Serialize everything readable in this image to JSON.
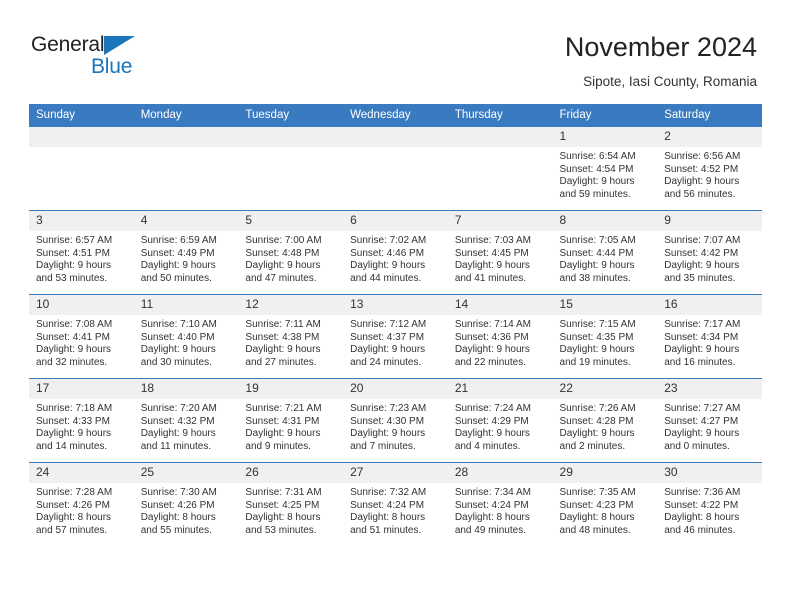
{
  "brand": {
    "name_part1": "General",
    "name_part2": "Blue",
    "triangle_icon": "blue-triangle-icon",
    "accent_color": "#1b75bb"
  },
  "header": {
    "title": "November 2024",
    "subtitle": "Sipote, Iasi County, Romania"
  },
  "theme": {
    "header_blue": "#3a7ac0",
    "daynum_bg": "#f0f0f0",
    "text": "#333333"
  },
  "weekday_headers": [
    "Sunday",
    "Monday",
    "Tuesday",
    "Wednesday",
    "Thursday",
    "Friday",
    "Saturday"
  ],
  "labels": {
    "sunrise": "Sunrise:",
    "sunset": "Sunset:",
    "daylight": "Daylight:"
  },
  "weeks": [
    [
      {
        "day": "",
        "empty": true
      },
      {
        "day": "",
        "empty": true
      },
      {
        "day": "",
        "empty": true
      },
      {
        "day": "",
        "empty": true
      },
      {
        "day": "",
        "empty": true
      },
      {
        "day": "1",
        "sunrise": "Sunrise: 6:54 AM",
        "sunset": "Sunset: 4:54 PM",
        "daylight_line1": "Daylight: 9 hours",
        "daylight_line2": "and 59 minutes."
      },
      {
        "day": "2",
        "sunrise": "Sunrise: 6:56 AM",
        "sunset": "Sunset: 4:52 PM",
        "daylight_line1": "Daylight: 9 hours",
        "daylight_line2": "and 56 minutes."
      }
    ],
    [
      {
        "day": "3",
        "sunrise": "Sunrise: 6:57 AM",
        "sunset": "Sunset: 4:51 PM",
        "daylight_line1": "Daylight: 9 hours",
        "daylight_line2": "and 53 minutes."
      },
      {
        "day": "4",
        "sunrise": "Sunrise: 6:59 AM",
        "sunset": "Sunset: 4:49 PM",
        "daylight_line1": "Daylight: 9 hours",
        "daylight_line2": "and 50 minutes."
      },
      {
        "day": "5",
        "sunrise": "Sunrise: 7:00 AM",
        "sunset": "Sunset: 4:48 PM",
        "daylight_line1": "Daylight: 9 hours",
        "daylight_line2": "and 47 minutes."
      },
      {
        "day": "6",
        "sunrise": "Sunrise: 7:02 AM",
        "sunset": "Sunset: 4:46 PM",
        "daylight_line1": "Daylight: 9 hours",
        "daylight_line2": "and 44 minutes."
      },
      {
        "day": "7",
        "sunrise": "Sunrise: 7:03 AM",
        "sunset": "Sunset: 4:45 PM",
        "daylight_line1": "Daylight: 9 hours",
        "daylight_line2": "and 41 minutes."
      },
      {
        "day": "8",
        "sunrise": "Sunrise: 7:05 AM",
        "sunset": "Sunset: 4:44 PM",
        "daylight_line1": "Daylight: 9 hours",
        "daylight_line2": "and 38 minutes."
      },
      {
        "day": "9",
        "sunrise": "Sunrise: 7:07 AM",
        "sunset": "Sunset: 4:42 PM",
        "daylight_line1": "Daylight: 9 hours",
        "daylight_line2": "and 35 minutes."
      }
    ],
    [
      {
        "day": "10",
        "sunrise": "Sunrise: 7:08 AM",
        "sunset": "Sunset: 4:41 PM",
        "daylight_line1": "Daylight: 9 hours",
        "daylight_line2": "and 32 minutes."
      },
      {
        "day": "11",
        "sunrise": "Sunrise: 7:10 AM",
        "sunset": "Sunset: 4:40 PM",
        "daylight_line1": "Daylight: 9 hours",
        "daylight_line2": "and 30 minutes."
      },
      {
        "day": "12",
        "sunrise": "Sunrise: 7:11 AM",
        "sunset": "Sunset: 4:38 PM",
        "daylight_line1": "Daylight: 9 hours",
        "daylight_line2": "and 27 minutes."
      },
      {
        "day": "13",
        "sunrise": "Sunrise: 7:12 AM",
        "sunset": "Sunset: 4:37 PM",
        "daylight_line1": "Daylight: 9 hours",
        "daylight_line2": "and 24 minutes."
      },
      {
        "day": "14",
        "sunrise": "Sunrise: 7:14 AM",
        "sunset": "Sunset: 4:36 PM",
        "daylight_line1": "Daylight: 9 hours",
        "daylight_line2": "and 22 minutes."
      },
      {
        "day": "15",
        "sunrise": "Sunrise: 7:15 AM",
        "sunset": "Sunset: 4:35 PM",
        "daylight_line1": "Daylight: 9 hours",
        "daylight_line2": "and 19 minutes."
      },
      {
        "day": "16",
        "sunrise": "Sunrise: 7:17 AM",
        "sunset": "Sunset: 4:34 PM",
        "daylight_line1": "Daylight: 9 hours",
        "daylight_line2": "and 16 minutes."
      }
    ],
    [
      {
        "day": "17",
        "sunrise": "Sunrise: 7:18 AM",
        "sunset": "Sunset: 4:33 PM",
        "daylight_line1": "Daylight: 9 hours",
        "daylight_line2": "and 14 minutes."
      },
      {
        "day": "18",
        "sunrise": "Sunrise: 7:20 AM",
        "sunset": "Sunset: 4:32 PM",
        "daylight_line1": "Daylight: 9 hours",
        "daylight_line2": "and 11 minutes."
      },
      {
        "day": "19",
        "sunrise": "Sunrise: 7:21 AM",
        "sunset": "Sunset: 4:31 PM",
        "daylight_line1": "Daylight: 9 hours",
        "daylight_line2": "and 9 minutes."
      },
      {
        "day": "20",
        "sunrise": "Sunrise: 7:23 AM",
        "sunset": "Sunset: 4:30 PM",
        "daylight_line1": "Daylight: 9 hours",
        "daylight_line2": "and 7 minutes."
      },
      {
        "day": "21",
        "sunrise": "Sunrise: 7:24 AM",
        "sunset": "Sunset: 4:29 PM",
        "daylight_line1": "Daylight: 9 hours",
        "daylight_line2": "and 4 minutes."
      },
      {
        "day": "22",
        "sunrise": "Sunrise: 7:26 AM",
        "sunset": "Sunset: 4:28 PM",
        "daylight_line1": "Daylight: 9 hours",
        "daylight_line2": "and 2 minutes."
      },
      {
        "day": "23",
        "sunrise": "Sunrise: 7:27 AM",
        "sunset": "Sunset: 4:27 PM",
        "daylight_line1": "Daylight: 9 hours",
        "daylight_line2": "and 0 minutes."
      }
    ],
    [
      {
        "day": "24",
        "sunrise": "Sunrise: 7:28 AM",
        "sunset": "Sunset: 4:26 PM",
        "daylight_line1": "Daylight: 8 hours",
        "daylight_line2": "and 57 minutes."
      },
      {
        "day": "25",
        "sunrise": "Sunrise: 7:30 AM",
        "sunset": "Sunset: 4:26 PM",
        "daylight_line1": "Daylight: 8 hours",
        "daylight_line2": "and 55 minutes."
      },
      {
        "day": "26",
        "sunrise": "Sunrise: 7:31 AM",
        "sunset": "Sunset: 4:25 PM",
        "daylight_line1": "Daylight: 8 hours",
        "daylight_line2": "and 53 minutes."
      },
      {
        "day": "27",
        "sunrise": "Sunrise: 7:32 AM",
        "sunset": "Sunset: 4:24 PM",
        "daylight_line1": "Daylight: 8 hours",
        "daylight_line2": "and 51 minutes."
      },
      {
        "day": "28",
        "sunrise": "Sunrise: 7:34 AM",
        "sunset": "Sunset: 4:24 PM",
        "daylight_line1": "Daylight: 8 hours",
        "daylight_line2": "and 49 minutes."
      },
      {
        "day": "29",
        "sunrise": "Sunrise: 7:35 AM",
        "sunset": "Sunset: 4:23 PM",
        "daylight_line1": "Daylight: 8 hours",
        "daylight_line2": "and 48 minutes."
      },
      {
        "day": "30",
        "sunrise": "Sunrise: 7:36 AM",
        "sunset": "Sunset: 4:22 PM",
        "daylight_line1": "Daylight: 8 hours",
        "daylight_line2": "and 46 minutes."
      }
    ]
  ]
}
